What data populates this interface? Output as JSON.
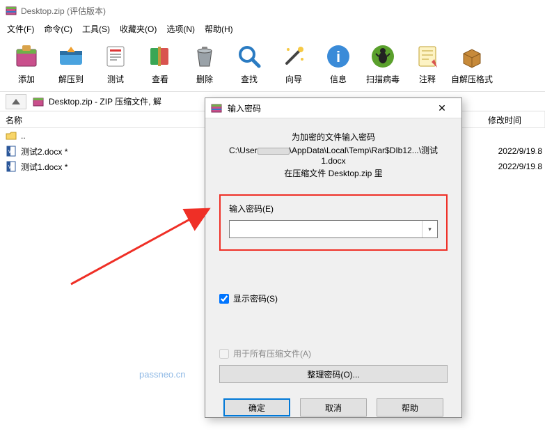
{
  "window": {
    "title": "Desktop.zip (评估版本)"
  },
  "menus": [
    "文件(F)",
    "命令(C)",
    "工具(S)",
    "收藏夹(O)",
    "选项(N)",
    "帮助(H)"
  ],
  "toolbar": [
    {
      "name": "add",
      "label": "添加"
    },
    {
      "name": "extract",
      "label": "解压到"
    },
    {
      "name": "test",
      "label": "测试"
    },
    {
      "name": "view",
      "label": "查看"
    },
    {
      "name": "delete",
      "label": "删除"
    },
    {
      "name": "find",
      "label": "查找"
    },
    {
      "name": "wizard",
      "label": "向导"
    },
    {
      "name": "info",
      "label": "信息"
    },
    {
      "name": "virus",
      "label": "扫描病毒"
    },
    {
      "name": "comment",
      "label": "注释"
    },
    {
      "name": "sfx",
      "label": "自解压格式"
    }
  ],
  "breadcrumb": {
    "path": "Desktop.zip - ZIP 压缩文件, 解"
  },
  "columns": {
    "name": "名称",
    "modified": "修改时间"
  },
  "files": [
    {
      "icon": "folder-up",
      "name": ".."
    },
    {
      "icon": "docx",
      "name": "测试2.docx *",
      "modified": "2022/9/19 8"
    },
    {
      "icon": "docx",
      "name": "测试1.docx *",
      "modified": "2022/9/19 8"
    }
  ],
  "dialog": {
    "title": "输入密码",
    "msg1": "为加密的文件输入密码",
    "path_prefix": "C:\\User",
    "path_suffix": "\\AppData\\Local\\Temp\\Rar$DIb12...\\测试1.docx",
    "msg3_prefix": "在压缩文件 ",
    "msg3_archive": "Desktop.zip",
    "msg3_suffix": " 里",
    "pw_label": "输入密码(E)",
    "show_pw": "显示密码(S)",
    "use_all": "用于所有压缩文件(A)",
    "organize": "整理密码(O)...",
    "ok": "确定",
    "cancel": "取消",
    "help": "帮助"
  },
  "watermark": "passneo.cn"
}
